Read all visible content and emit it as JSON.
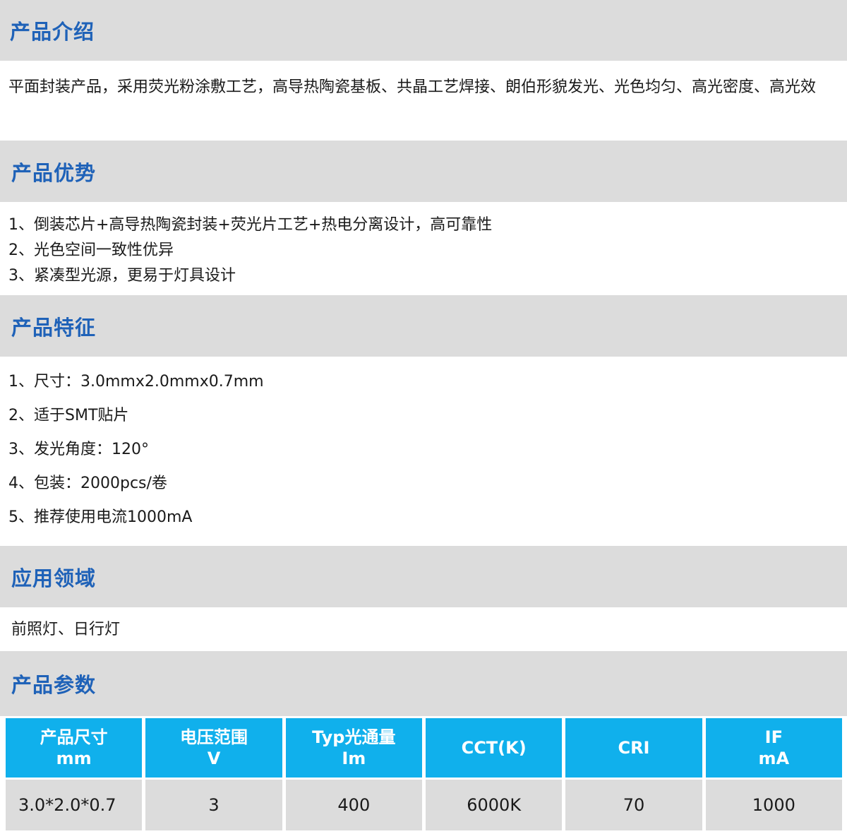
{
  "sections": {
    "intro": {
      "title": "产品介绍",
      "text": "平面封装产品，采用荧光粉涂敷工艺，高导热陶瓷基板、共晶工艺焊接、朗伯形貌发光、光色均匀、高光密度、高光效"
    },
    "advantages": {
      "title": "产品优势",
      "items": [
        "1、倒装芯片+高导热陶瓷封装+荧光片工艺+热电分离设计，高可靠性",
        "2、光色空间一致性优异",
        "3、紧凑型光源，更易于灯具设计"
      ]
    },
    "features": {
      "title": "产品特征",
      "items": [
        "1、尺寸：3.0mmx2.0mmx0.7mm",
        "2、适于SMT贴片",
        "3、发光角度：120°",
        "4、包装：2000pcs/卷",
        "5、推荐使用电流1000mA"
      ]
    },
    "applications": {
      "title": "应用领域",
      "text": "前照灯、日行灯"
    },
    "parameters": {
      "title": "产品参数",
      "headers": [
        {
          "line1": "产品尺寸",
          "line2": "mm"
        },
        {
          "line1": "电压范围",
          "line2": "V"
        },
        {
          "line1": "Typ光通量",
          "line2": "Im"
        },
        {
          "line1": "CCT(K)",
          "line2": ""
        },
        {
          "line1": "CRI",
          "line2": ""
        },
        {
          "line1": "IF",
          "line2": "mA"
        }
      ],
      "row": [
        "3.0*2.0*0.7",
        "3",
        "400",
        "6000K",
        "70",
        "1000"
      ]
    }
  },
  "colors": {
    "section_band": "#dcdcdc",
    "section_title": "#1f62b8",
    "table_header": "#10b0ec",
    "table_cell": "#dcdcdc"
  }
}
